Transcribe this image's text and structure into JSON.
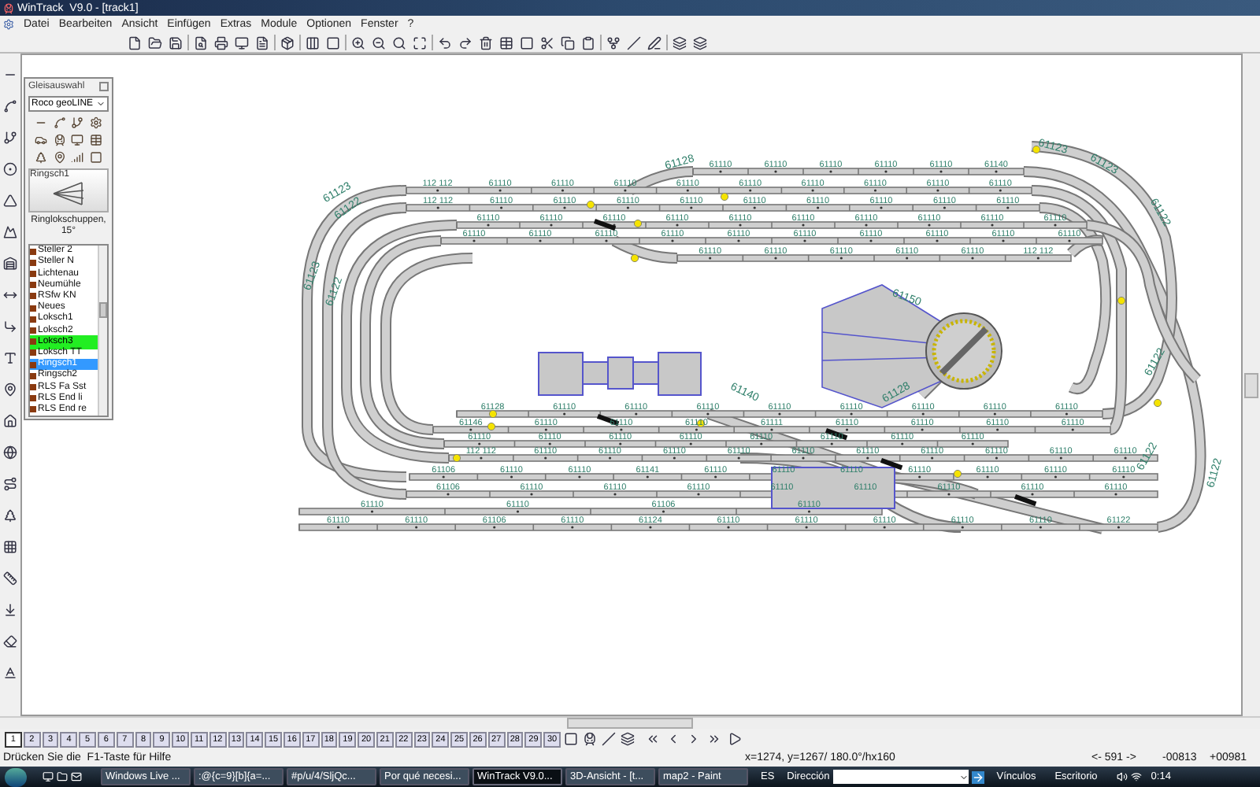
{
  "window": {
    "title": "WinTrack  V9.0 - [track1]"
  },
  "menu": [
    "Datei",
    "Bearbeiten",
    "Ansicht",
    "Einfügen",
    "Extras",
    "Module",
    "Optionen",
    "Fenster",
    "?"
  ],
  "panel": {
    "title": "Gleisauswahl",
    "dropdown": "Roco geoLINE",
    "preview_label": "Ringsch1",
    "caption": "Ringlokschuppen, 15°",
    "items": [
      {
        "label": "Steller 2",
        "selected": false,
        "highlighted": false
      },
      {
        "label": "Steller N",
        "selected": false,
        "highlighted": false
      },
      {
        "label": "Lichtenau",
        "selected": false,
        "highlighted": false
      },
      {
        "label": "Neumühle",
        "selected": false,
        "highlighted": false
      },
      {
        "label": "RSfw KN",
        "selected": false,
        "highlighted": false
      },
      {
        "label": "Neues",
        "selected": false,
        "highlighted": false
      },
      {
        "label": "Loksch1",
        "selected": false,
        "highlighted": false
      },
      {
        "label": "Loksch2",
        "selected": false,
        "highlighted": false
      },
      {
        "label": "Loksch3",
        "selected": false,
        "highlighted": true
      },
      {
        "label": "Loksch TT",
        "selected": false,
        "highlighted": false
      },
      {
        "label": "Ringsch1",
        "selected": true,
        "highlighted": false
      },
      {
        "label": "Ringsch2",
        "selected": false,
        "highlighted": false
      },
      {
        "label": "RLS Fa Sst",
        "selected": false,
        "highlighted": false
      },
      {
        "label": "RLS End li",
        "selected": false,
        "highlighted": false
      },
      {
        "label": "RLS End re",
        "selected": false,
        "highlighted": false
      }
    ]
  },
  "track_plan": {
    "rows": [
      {
        "labels": [
          "61110",
          "61110",
          "61110",
          "61110",
          "61110",
          "61140"
        ]
      },
      {
        "labels": [
          "112 112",
          "61110",
          "61110",
          "61110",
          "61110",
          "61110",
          "61110",
          "61110",
          "61110",
          "61110"
        ]
      },
      {
        "labels": [
          "112 112",
          "61110",
          "61110",
          "61110",
          "61110",
          "61110",
          "61110",
          "61110",
          "61110",
          "61110"
        ]
      },
      {
        "labels": [
          "61110",
          "61110",
          "61110",
          "61110",
          "61110",
          "61110",
          "61110",
          "61110",
          "61110",
          "61110"
        ]
      },
      {
        "labels": [
          "61110",
          "61110",
          "61110",
          "61110",
          "61110",
          "61110",
          "61110",
          "61110",
          "61110",
          "61110"
        ]
      },
      {
        "labels": [
          "61110",
          "61110",
          "61110",
          "61110",
          "61110",
          "112 112"
        ]
      },
      {
        "labels": [
          "61128",
          "61110",
          "61110",
          "61110",
          "61110",
          "61110",
          "61110",
          "61110",
          "61110"
        ]
      },
      {
        "labels": [
          "61146",
          "61110",
          "61110",
          "61110",
          "61111",
          "61110",
          "61110",
          "61110",
          "61110"
        ]
      },
      {
        "labels": [
          "61110",
          "61110",
          "61110",
          "61110",
          "61110",
          "61110",
          "61110",
          "61110"
        ]
      },
      {
        "labels": [
          "112 112",
          "61110",
          "61110",
          "61110",
          "61110",
          "61110",
          "61110",
          "61110",
          "61110",
          "61110",
          "61110"
        ]
      },
      {
        "labels": [
          "61106",
          "61110",
          "61110",
          "61141",
          "61110",
          "61110",
          "61110",
          "61110",
          "61110",
          "61110",
          "61110"
        ]
      },
      {
        "labels": [
          "61106",
          "61110",
          "61110",
          "61110",
          "61110",
          "61110",
          "61110",
          "61110",
          "61110"
        ]
      },
      {
        "labels": [
          "61110",
          "61110",
          "61106",
          "61110"
        ]
      },
      {
        "labels": [
          "61110",
          "61110",
          "61106",
          "61110",
          "61124",
          "61110",
          "61110",
          "61110",
          "61110",
          "61110",
          "61122"
        ]
      }
    ],
    "curve_labels": [
      "61123",
      "61122",
      "61123",
      "61122",
      "61128",
      "61123",
      "61123",
      "61122",
      "61122",
      "61150",
      "61128",
      "61122",
      "61122",
      "61140"
    ]
  },
  "page_tabs": [
    {
      "label": "1",
      "selected": true
    },
    {
      "label": "2",
      "selected": false
    },
    {
      "label": "3",
      "selected": false
    },
    {
      "label": "4",
      "selected": false
    },
    {
      "label": "5",
      "selected": false
    },
    {
      "label": "6",
      "selected": false
    },
    {
      "label": "7",
      "selected": false
    },
    {
      "label": "8",
      "selected": false
    },
    {
      "label": "9",
      "selected": false
    },
    {
      "label": "10",
      "selected": false
    },
    {
      "label": "11",
      "selected": false
    },
    {
      "label": "12",
      "selected": false
    },
    {
      "label": "13",
      "selected": false
    },
    {
      "label": "14",
      "selected": false
    },
    {
      "label": "15",
      "selected": false
    },
    {
      "label": "16",
      "selected": false
    },
    {
      "label": "17",
      "selected": false
    },
    {
      "label": "18",
      "selected": false
    },
    {
      "label": "19",
      "selected": false
    },
    {
      "label": "20",
      "selected": false
    },
    {
      "label": "21",
      "selected": false
    },
    {
      "label": "22",
      "selected": false
    },
    {
      "label": "23",
      "selected": false
    },
    {
      "label": "24",
      "selected": false
    },
    {
      "label": "25",
      "selected": false
    },
    {
      "label": "26",
      "selected": false
    },
    {
      "label": "27",
      "selected": false
    },
    {
      "label": "28",
      "selected": false
    },
    {
      "label": "29",
      "selected": false
    },
    {
      "label": "30",
      "selected": false
    }
  ],
  "status_bar": {
    "hint": "Drücken Sie die  F1-Taste für Hilfe",
    "coords": "x=1274, y=1267/ 180.0°/hx160",
    "distance": "<- 591 ->",
    "x_value": "-00813",
    "y_value": "+00981"
  },
  "taskbar": {
    "items": [
      {
        "label": "Windows Live ...",
        "selected": false
      },
      {
        "label": ":@{c=9}[b]{a=...",
        "selected": false
      },
      {
        "label": "#p/u/4/SljQc...",
        "selected": false
      },
      {
        "label": "Por qué necesi...",
        "selected": false
      },
      {
        "label": "WinTrack  V9.0...",
        "selected": true
      },
      {
        "label": "3D-Ansicht - [t...",
        "selected": false
      },
      {
        "label": "map2 - Paint",
        "selected": false
      }
    ],
    "language": "ES",
    "address_label": "Dirección",
    "links": "Vínculos",
    "desktop": "Escritorio",
    "clock": "0:14"
  }
}
